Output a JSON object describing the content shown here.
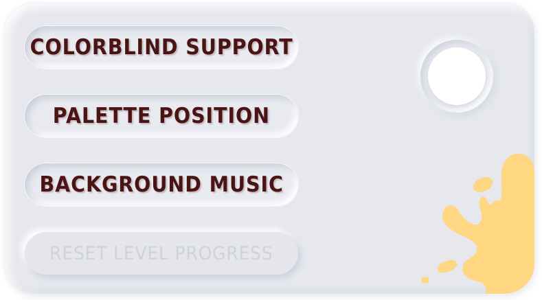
{
  "menu": {
    "items": [
      {
        "label": "COLORBLIND SUPPORT",
        "enabled": true
      },
      {
        "label": "PALETTE POSITION",
        "enabled": true
      },
      {
        "label": "BACKGROUND MUSIC",
        "enabled": true
      },
      {
        "label": "RESET LEVEL PROGRESS",
        "enabled": false
      }
    ]
  },
  "toggle": {
    "state": "on"
  },
  "colors": {
    "panel": "#e6e8ee",
    "label_text": "#4a1414",
    "disabled_text": "#cfd2da",
    "paint_splash": "#ffd783"
  }
}
